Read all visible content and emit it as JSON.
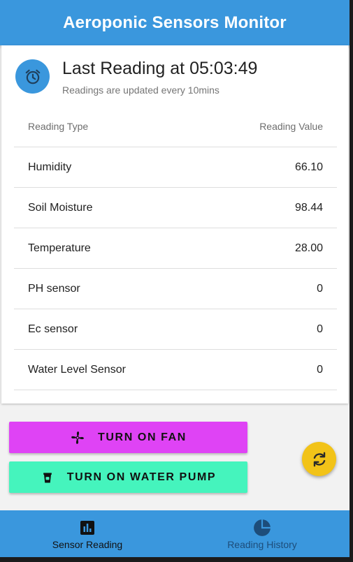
{
  "appbar": {
    "title": "Aeroponic Sensors Monitor"
  },
  "reading": {
    "icon": "alarm-clock-icon",
    "title": "Last Reading at 05:03:49",
    "subtitle": "Readings are updated every 10mins"
  },
  "table": {
    "headers": {
      "type": "Reading Type",
      "value": "Reading Value"
    },
    "rows": [
      {
        "type": "Humidity",
        "value": "66.10"
      },
      {
        "type": "Soil Moisture",
        "value": "98.44"
      },
      {
        "type": "Temperature",
        "value": "28.00"
      },
      {
        "type": "PH sensor",
        "value": "0"
      },
      {
        "type": "Ec sensor",
        "value": "0"
      },
      {
        "type": "Water Level Sensor",
        "value": "0"
      }
    ]
  },
  "buttons": {
    "fan": {
      "label": "TURN ON FAN",
      "icon": "fan-icon",
      "color": "#df43f5"
    },
    "pump": {
      "label": "TURN ON WATER PUMP",
      "icon": "water-bucket-icon",
      "color": "#45f4bd"
    }
  },
  "fab": {
    "icon": "refresh-icon",
    "color": "#f2c318"
  },
  "bottom_nav": {
    "items": [
      {
        "label": "Sensor Reading",
        "icon": "bar-chart-icon",
        "active": true
      },
      {
        "label": "Reading History",
        "icon": "pie-chart-icon",
        "active": false
      }
    ]
  },
  "colors": {
    "primary": "#3a97dd",
    "background": "#f2f2f2"
  }
}
